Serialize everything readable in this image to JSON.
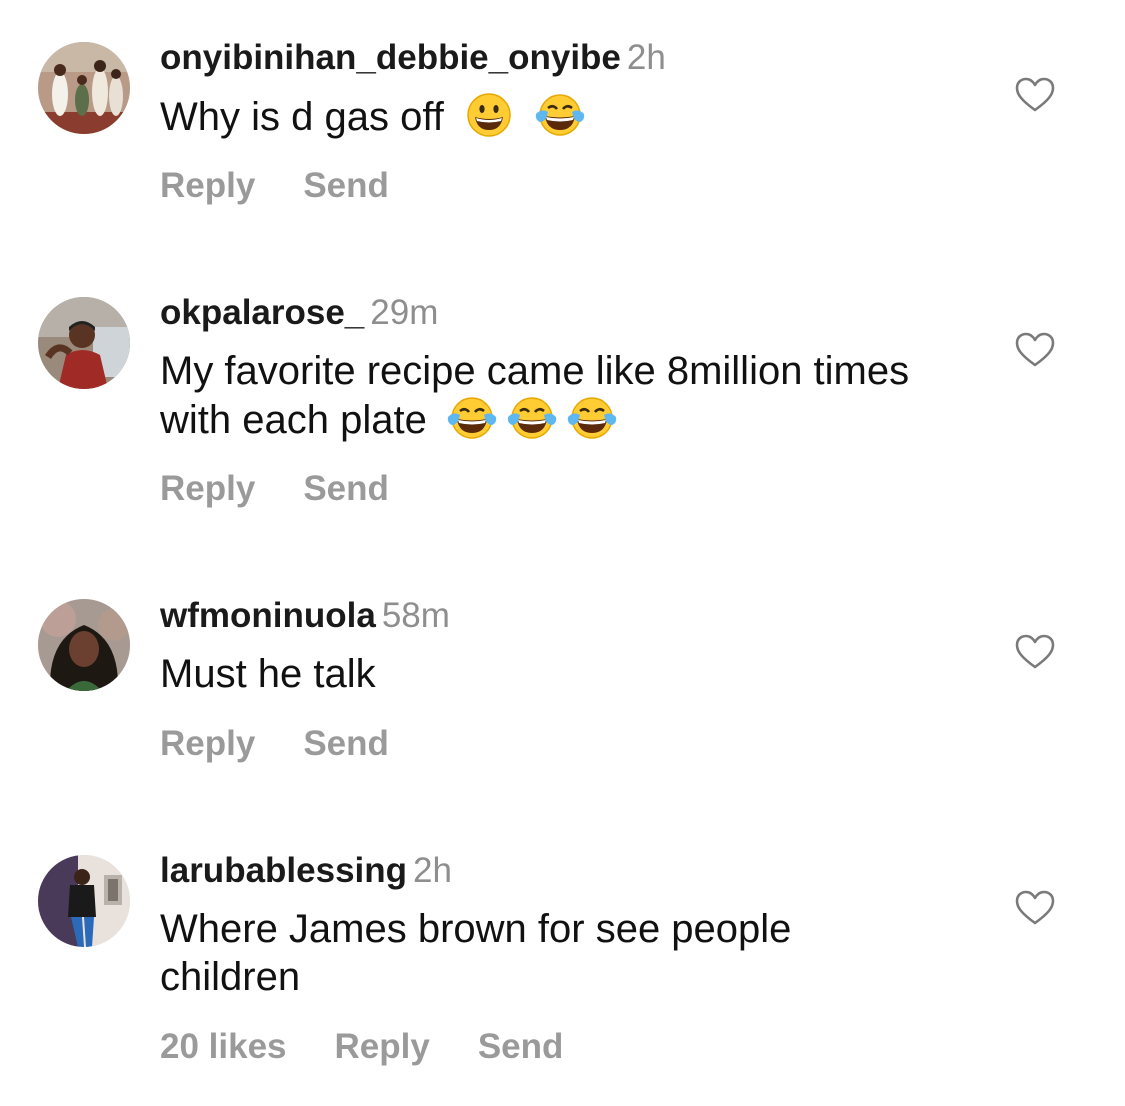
{
  "comments": [
    {
      "username": "onyibinihan_debbie_onyibe",
      "time": "2h",
      "text": "Why is d gas off",
      "emojis": [
        "grinning-face",
        "face-with-tears-of-joy"
      ],
      "likes": "",
      "reply_label": "Reply",
      "send_label": "Send"
    },
    {
      "username": "okpalarose_",
      "time": "29m",
      "text": "My favorite recipe came like 8million times with each plate",
      "emojis": [
        "face-with-tears-of-joy",
        "face-with-tears-of-joy",
        "face-with-tears-of-joy"
      ],
      "likes": "",
      "reply_label": "Reply",
      "send_label": "Send"
    },
    {
      "username": "wfmoninuola",
      "time": "58m",
      "text": "Must he talk",
      "emojis": [],
      "likes": "",
      "reply_label": "Reply",
      "send_label": "Send"
    },
    {
      "username": "larubablessing",
      "time": "2h",
      "text": "Where James brown for see people children",
      "emojis": [],
      "likes": "20 likes",
      "reply_label": "Reply",
      "send_label": "Send"
    }
  ],
  "icons": {
    "like": "heart-outline-icon"
  },
  "colors": {
    "secondary_text": "#8e8e8e",
    "action_text": "#9a9a9a",
    "primary_text": "#111111"
  }
}
